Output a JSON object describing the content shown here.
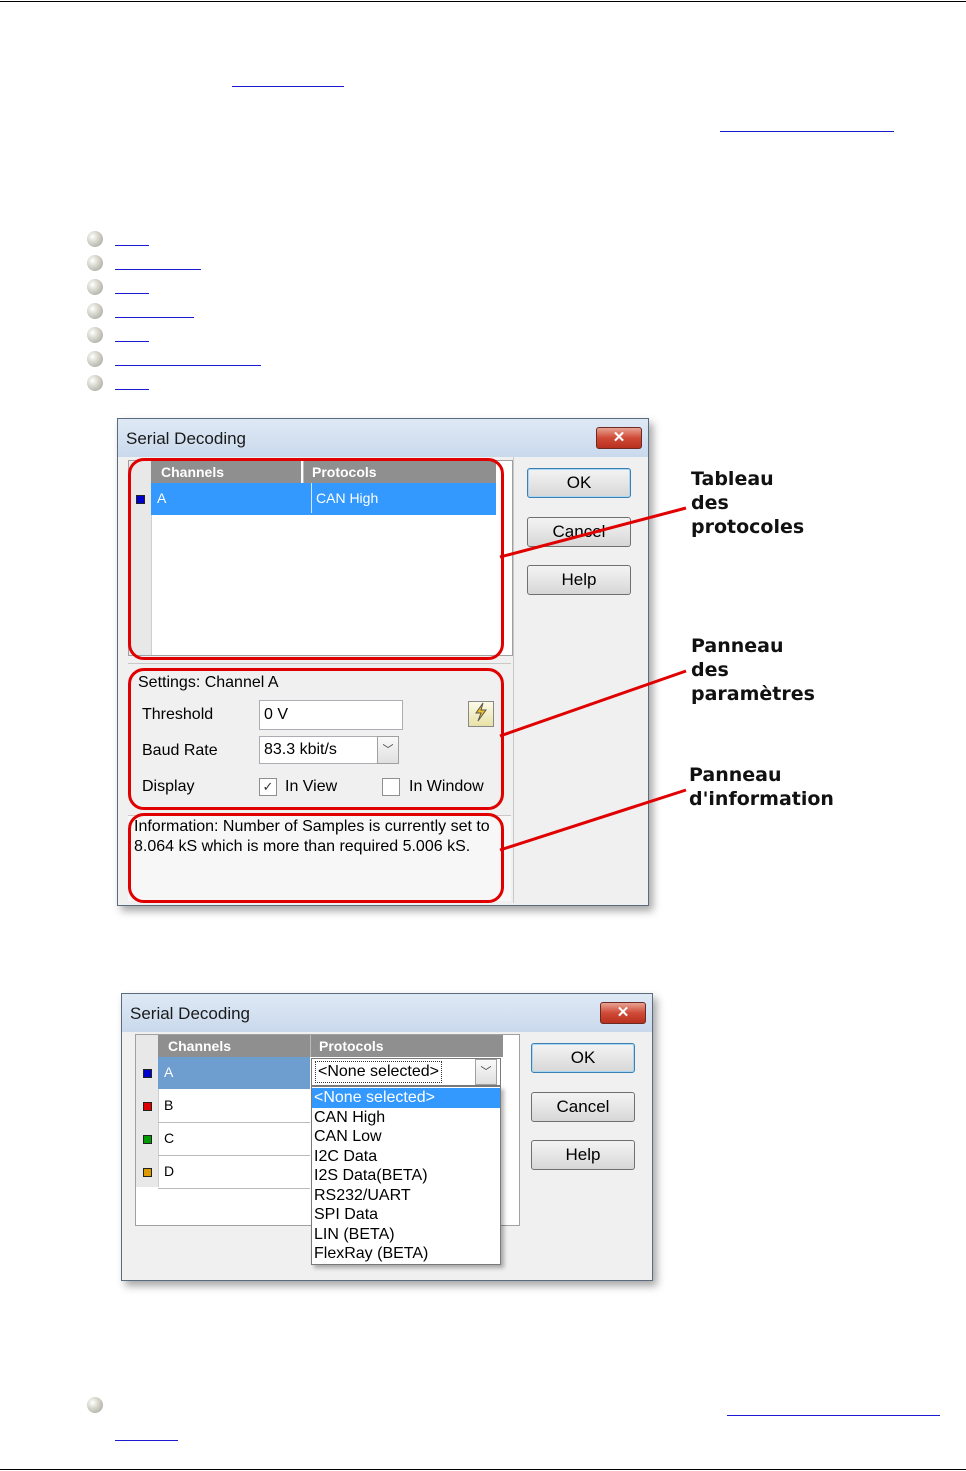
{
  "dialog1": {
    "title": "Serial Decoding",
    "close_label": "✕",
    "table": {
      "col_channels": "Channels",
      "col_protocols": "Protocols",
      "rows": [
        {
          "channel": "A",
          "protocol": "CAN High",
          "color": "#0000cc"
        }
      ]
    },
    "buttons": {
      "ok": "OK",
      "cancel": "Cancel",
      "help": "Help"
    },
    "settings": {
      "heading": "Settings: Channel A",
      "threshold_label": "Threshold",
      "threshold_value": "0 V",
      "baud_label": "Baud Rate",
      "baud_value": "83.3 kbit/s",
      "display_label": "Display",
      "in_view_label": "In View",
      "in_view_checked": true,
      "in_window_label": "In Window",
      "in_window_checked": false
    },
    "info": "Information: Number of Samples is currently set to 8.064 kS which is more than required 5.006 kS."
  },
  "callouts": {
    "protocol_table": [
      "Tableau",
      "des",
      "protocoles"
    ],
    "settings_panel": [
      "Panneau",
      "des",
      "paramètres"
    ],
    "info_panel": [
      "Panneau",
      "d'information"
    ]
  },
  "dialog2": {
    "title": "Serial Decoding",
    "close_label": "✕",
    "col_channels": "Channels",
    "col_protocols": "Protocols",
    "channels": [
      {
        "name": "A",
        "color": "#0000cc"
      },
      {
        "name": "B",
        "color": "#dd0000"
      },
      {
        "name": "C",
        "color": "#009900"
      },
      {
        "name": "D",
        "color": "#dd9900"
      }
    ],
    "combo_value": "<None selected>",
    "options": [
      "<None selected>",
      "CAN High",
      "CAN Low",
      "I2C Data",
      "I2S Data(BETA)",
      "RS232/UART",
      "SPI Data",
      "LIN (BETA)",
      "FlexRay (BETA)"
    ],
    "selected_option": 0,
    "buttons": {
      "ok": "OK",
      "cancel": "Cancel",
      "help": "Help"
    }
  },
  "colors": {
    "selection": "#3399ff",
    "callout_box": "#e00000",
    "link": "#1a1ad0"
  }
}
